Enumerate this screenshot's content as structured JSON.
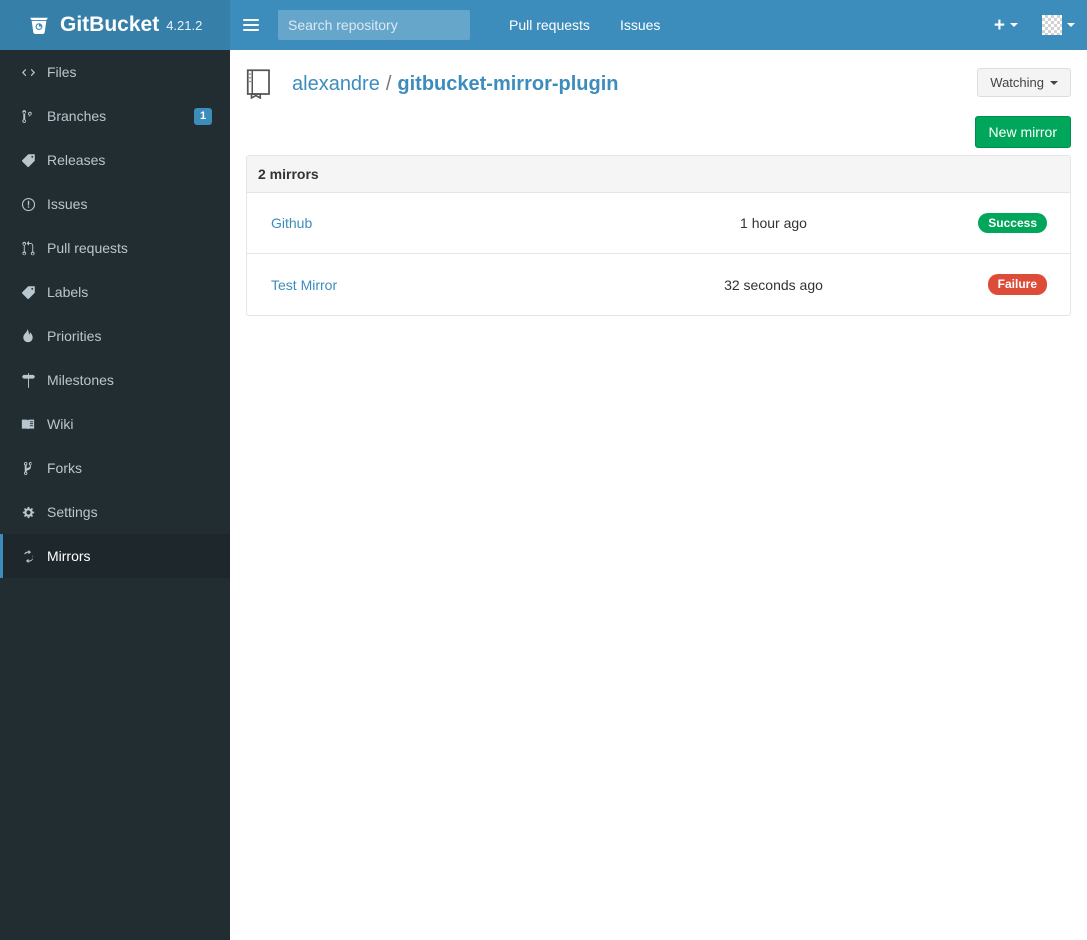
{
  "navbar": {
    "brand_name": "GitBucket",
    "version": "4.21.2",
    "logo_icon": "gitbucket-logo-icon",
    "sidebar_toggle_icon": "hamburger-icon",
    "search": {
      "value": "",
      "placeholder": "Search repository"
    },
    "links": [
      {
        "label": "Pull requests",
        "name": "nav-link-pull-requests"
      },
      {
        "label": "Issues",
        "name": "nav-link-issues"
      }
    ],
    "tools": {
      "create_icon": "plus-icon",
      "create_caret_icon": "chevron-down-icon",
      "avatar_icon": "avatar",
      "avatar_caret_icon": "chevron-down-icon"
    }
  },
  "sidebar": {
    "items": [
      {
        "label": "Files",
        "icon": "code-icon",
        "badge": "",
        "active": false
      },
      {
        "label": "Branches",
        "icon": "git-branch-icon",
        "badge": "1",
        "active": false
      },
      {
        "label": "Releases",
        "icon": "tag-icon",
        "badge": "",
        "active": false
      },
      {
        "label": "Issues",
        "icon": "issue-opened-icon",
        "badge": "",
        "active": false
      },
      {
        "label": "Pull requests",
        "icon": "git-pull-request-icon",
        "badge": "",
        "active": false
      },
      {
        "label": "Labels",
        "icon": "tag-icon",
        "badge": "",
        "active": false
      },
      {
        "label": "Priorities",
        "icon": "flame-icon",
        "badge": "",
        "active": false
      },
      {
        "label": "Milestones",
        "icon": "milestone-icon",
        "badge": "",
        "active": false
      },
      {
        "label": "Wiki",
        "icon": "book-icon",
        "badge": "",
        "active": false
      },
      {
        "label": "Forks",
        "icon": "repo-forked-icon",
        "badge": "",
        "active": false
      },
      {
        "label": "Settings",
        "icon": "gear-icon",
        "badge": "",
        "active": false
      },
      {
        "label": "Mirrors",
        "icon": "sync-icon",
        "badge": "",
        "active": true
      }
    ]
  },
  "repo": {
    "icon": "repo-icon",
    "owner": "alexandre",
    "separator": "/",
    "name": "gitbucket-mirror-plugin",
    "watch_label": "Watching",
    "watch_caret_icon": "chevron-down-icon"
  },
  "main": {
    "new_mirror_label": "New mirror",
    "panel_heading": "2 mirrors",
    "mirrors": [
      {
        "name": "Github",
        "time": "1 hour ago",
        "status": "Success",
        "status_type": "success"
      },
      {
        "name": "Test Mirror",
        "time": "32 seconds ago",
        "status": "Failure",
        "status_type": "failure"
      }
    ]
  },
  "colors": {
    "navbar_blue": "#3c8dbc",
    "brand_blue": "#367fa9",
    "sidebar_dark": "#222d32",
    "sidebar_active": "#1e282c",
    "link_blue": "#3c8dbc",
    "success_green": "#00a65a",
    "failure_red": "#dd4b39"
  }
}
